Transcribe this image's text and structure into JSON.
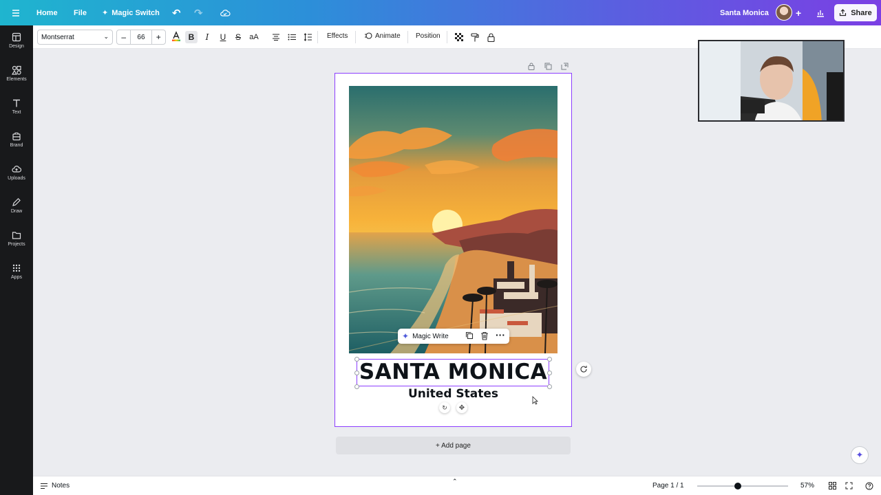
{
  "topbar": {
    "home": "Home",
    "file": "File",
    "magic_switch": "Magic Switch",
    "doc_title": "Santa Monica",
    "share": "Share"
  },
  "rail": {
    "items": [
      {
        "label": "Design",
        "icon": "layout-icon"
      },
      {
        "label": "Elements",
        "icon": "shapes-icon"
      },
      {
        "label": "Text",
        "icon": "text-icon"
      },
      {
        "label": "Brand",
        "icon": "brand-icon"
      },
      {
        "label": "Uploads",
        "icon": "upload-icon"
      },
      {
        "label": "Draw",
        "icon": "draw-icon"
      },
      {
        "label": "Projects",
        "icon": "folder-icon"
      },
      {
        "label": "Apps",
        "icon": "apps-icon"
      }
    ]
  },
  "format": {
    "font": "Montserrat",
    "size": "66",
    "minus": "–",
    "plus": "+",
    "effects": "Effects",
    "animate": "Animate",
    "position": "Position"
  },
  "canvas": {
    "title": "SANTA MONICA",
    "subtitle": "United States",
    "magic_write": "Magic Write",
    "add_page": "+ Add page"
  },
  "bottom": {
    "notes": "Notes",
    "page": "Page 1 / 1",
    "zoom": "57%"
  },
  "colors": {
    "accent": "#8b3dff",
    "rail_bg": "#18191b"
  }
}
